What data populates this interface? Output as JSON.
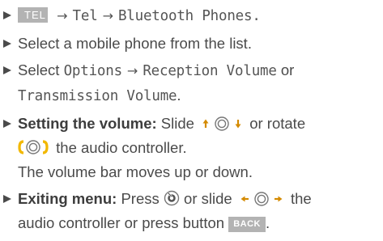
{
  "steps": [
    {
      "key_tel": "TEL",
      "arrow1": "→",
      "menu1": "Tel",
      "arrow2": "→",
      "menu2": "Bluetooth Phones."
    },
    {
      "text": "Select a mobile phone from the list."
    },
    {
      "prefix": "Select",
      "menu1": "Options",
      "arrow": "→",
      "menu2": "Reception Volume",
      "joiner": "or",
      "menu3": "Transmission Volume",
      "suffix": "."
    },
    {
      "bold": "Setting the volume:",
      "text1": "Slide",
      "text2": "or rotate",
      "text3": "the audio controller.",
      "line2": "The volume bar moves up or down."
    },
    {
      "bold": "Exiting menu:",
      "text1": "Press",
      "text2": "or slide",
      "text3": "the",
      "text4": "audio controller or press button",
      "key_back": "BACK",
      "suffix": "."
    }
  ],
  "icons": {
    "bullet": "triangle-bullet-icon",
    "slide_vertical": "controller-slide-up-down-icon",
    "rotate": "controller-rotate-icon",
    "press": "controller-press-icon",
    "slide_horizontal": "controller-slide-left-right-icon"
  },
  "colors": {
    "text": "#4a4a4a",
    "key_bg": "#b3b3b3",
    "rotate_accent": "#f2b800"
  }
}
